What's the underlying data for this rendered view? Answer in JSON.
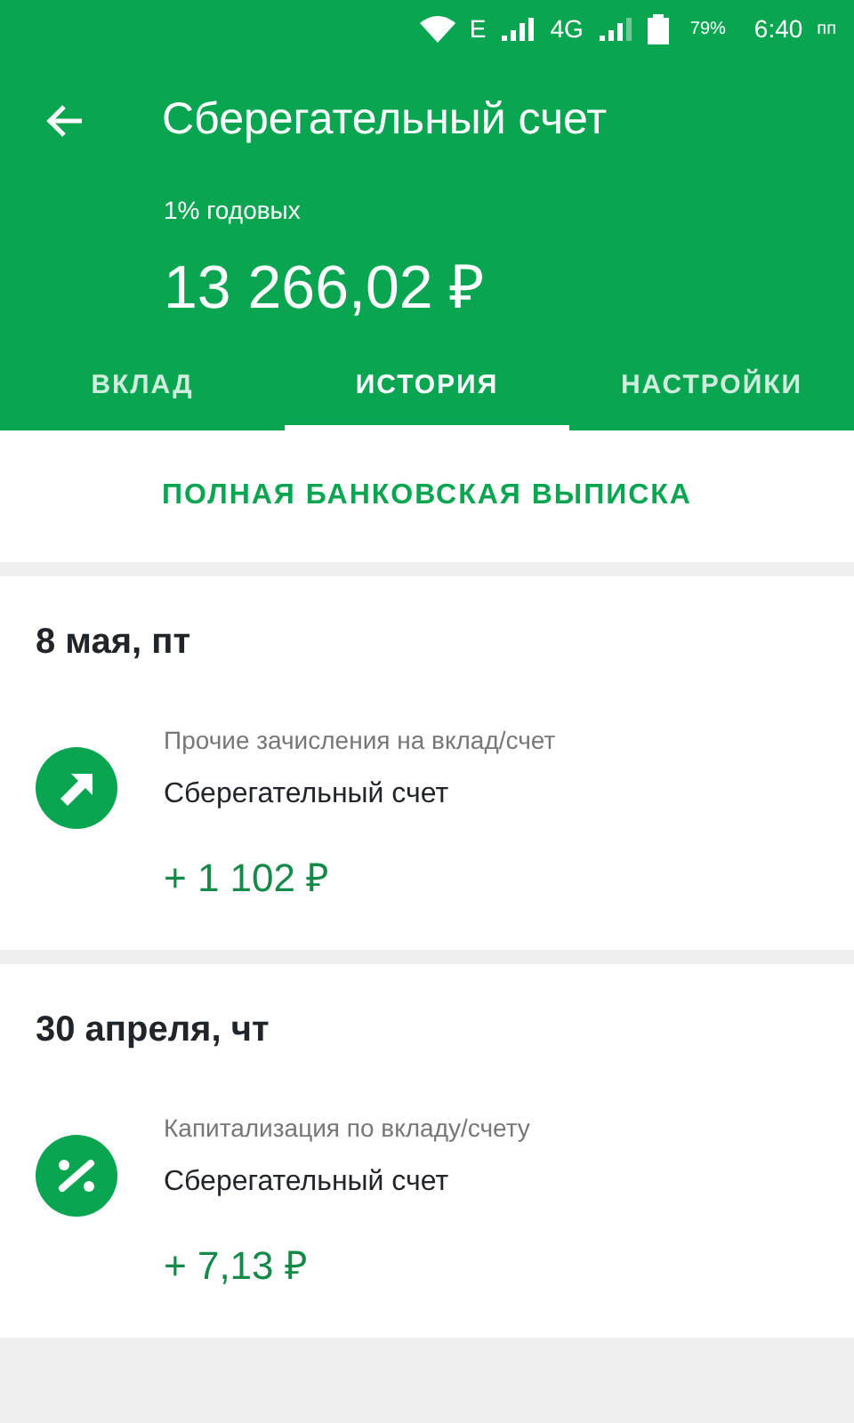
{
  "status_bar": {
    "network": "E",
    "network_2": "4G",
    "battery": "79%",
    "time": "6:40",
    "time_suffix": "пп"
  },
  "header": {
    "title": "Сберегательный счет",
    "rate": "1% годовых",
    "balance": "13 266,02 ₽"
  },
  "tabs": [
    {
      "label": "ВКЛАД",
      "selected": false
    },
    {
      "label": "ИСТОРИЯ",
      "selected": true
    },
    {
      "label": "НАСТРОЙКИ",
      "selected": false
    }
  ],
  "statement_link": "ПОЛНАЯ БАНКОВСКАЯ ВЫПИСКА",
  "days": [
    {
      "date": "8 мая, пт",
      "operations": [
        {
          "kind": "transfer",
          "category": "Прочие зачисления на вклад/счет",
          "account": "Сберегательный счет",
          "amount": "+ 1 102 ₽"
        }
      ]
    },
    {
      "date": "30 апреля, чт",
      "operations": [
        {
          "kind": "capitalization",
          "category": "Капитализация по вкладу/счету",
          "account": "Сберегательный счет",
          "amount": "+ 7,13 ₽"
        }
      ]
    }
  ]
}
